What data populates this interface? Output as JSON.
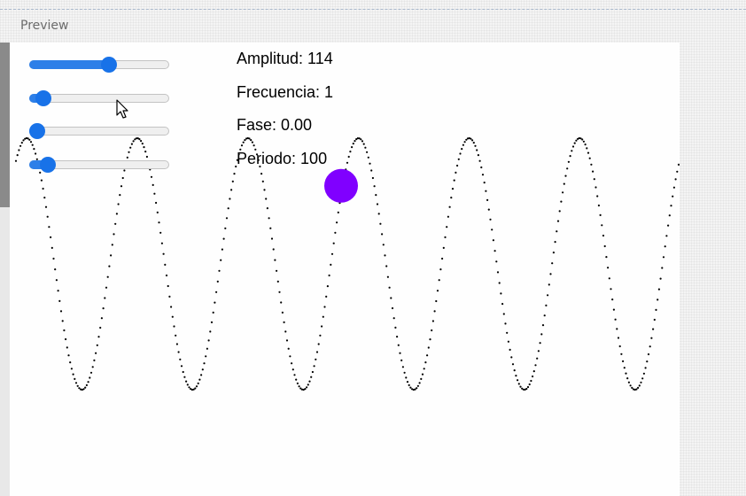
{
  "panel": {
    "title": "Preview"
  },
  "controls": {
    "amplitude": {
      "label": "Amplitud: 114",
      "level": 0.57
    },
    "frequency": {
      "label": "Frecuencia: 1",
      "level": 0.1
    },
    "phase": {
      "label": "Fase: 0.00",
      "level": 0.0
    },
    "period": {
      "label": "Periodo: 100",
      "level": 0.13
    }
  },
  "wave": {
    "cycles": 6,
    "ball_progress": 0.49
  },
  "colors": {
    "accent": "#1872e8",
    "ball": "#8000ff",
    "wave": "#000000"
  },
  "icons": {
    "cursor": "pointer-cursor-icon"
  }
}
